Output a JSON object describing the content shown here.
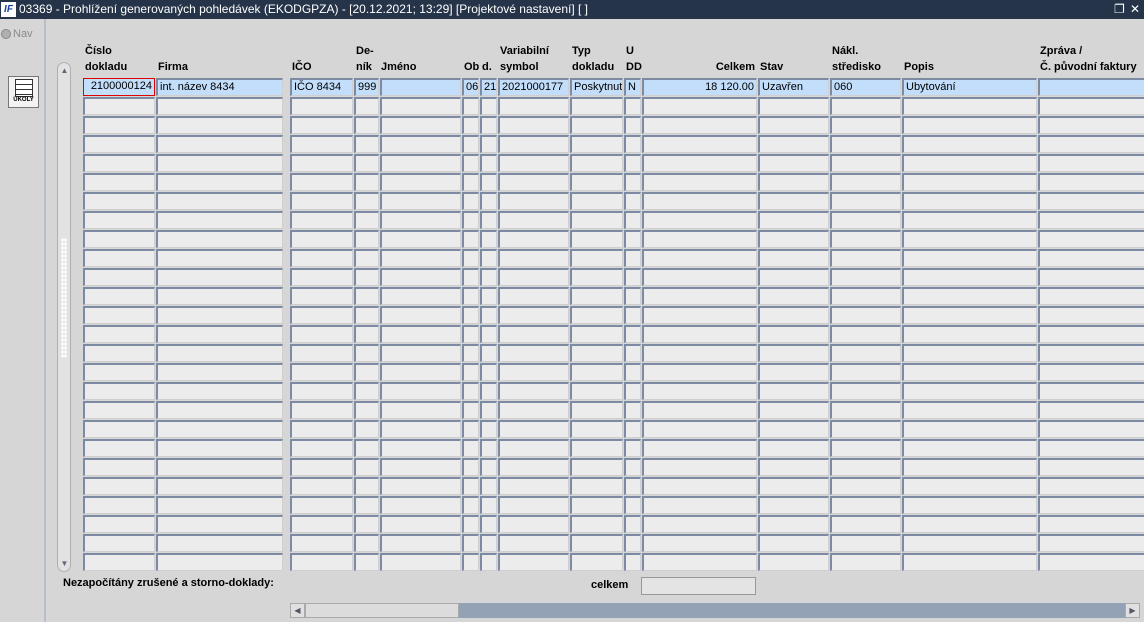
{
  "window": {
    "title": "03369 - Prohlížení generovaných pohledávek (EKODGPZA) - [20.12.2021; 13:29]  [Projektové nastavení]  [ ]",
    "logo": "IF",
    "restore_icon": "❐",
    "close_icon": "✕"
  },
  "left": {
    "nav_label": "Nav",
    "ukoly_label": "ÚKOLY"
  },
  "columns": [
    {
      "key": "cislo",
      "line1": "Číslo",
      "line2": "dokladu"
    },
    {
      "key": "firma",
      "line1": "",
      "line2": "Firma"
    },
    {
      "key": "ico",
      "line1": "",
      "line2": "IČO"
    },
    {
      "key": "denik",
      "line1": "De-",
      "line2": "ník"
    },
    {
      "key": "jmeno",
      "line1": "",
      "line2": "Jméno"
    },
    {
      "key": "ob",
      "line1": "",
      "line2": "Ob"
    },
    {
      "key": "d",
      "line1": "",
      "line2": "d."
    },
    {
      "key": "vs",
      "line1": "Variabilní",
      "line2": "symbol"
    },
    {
      "key": "typ",
      "line1": "Typ",
      "line2": "dokladu"
    },
    {
      "key": "udd",
      "line1": "U",
      "line2": "DD"
    },
    {
      "key": "celkem",
      "line1": "",
      "line2": "Celkem"
    },
    {
      "key": "stav",
      "line1": "",
      "line2": "Stav"
    },
    {
      "key": "nakl",
      "line1": "Nákl.",
      "line2": "středisko"
    },
    {
      "key": "popis",
      "line1": "",
      "line2": "Popis"
    },
    {
      "key": "zprava",
      "line1": "Zpráva /",
      "line2": "Č. původní faktury"
    }
  ],
  "rows": [
    {
      "cislo": "2100000124",
      "firma": "int. název 8434",
      "ico": "IČO 8434",
      "denik": "999",
      "jmeno": "",
      "ob": "06",
      "d": "21",
      "vs": "2021000177",
      "typ": "Poskytnuté",
      "udd": "N",
      "celkem": "18 120.00",
      "stav": "Uzavřen",
      "nakl": "060",
      "popis": "Ubytování",
      "zprava": ""
    }
  ],
  "footer": {
    "note": "Nezapočítány zrušené a storno-doklady:",
    "total_label": "celkem",
    "total_value": ""
  },
  "colors": {
    "titlebar": "#253449",
    "selected_row": "#c3defa",
    "current_cell_border": "#e00000"
  }
}
